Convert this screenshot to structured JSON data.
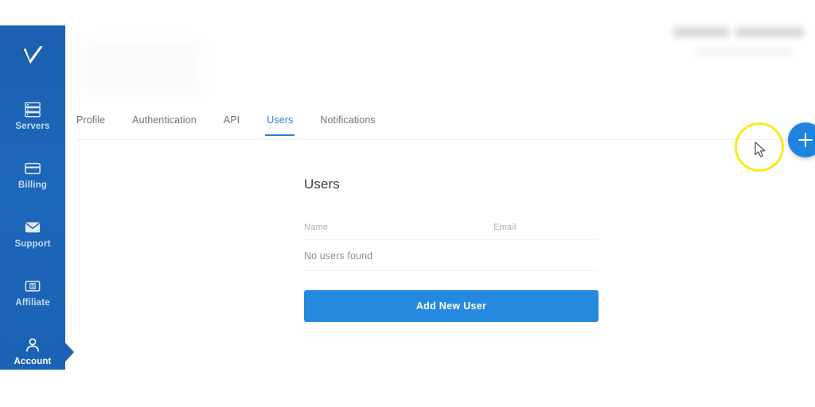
{
  "brand": {
    "logo_name": "checkmark-logo",
    "sidebar_color": "#1a62b4",
    "accent_color": "#2589e0",
    "tab_active_color": "#2b7fd4",
    "highlight_color": "#f5eb18"
  },
  "sidebar": {
    "items": [
      {
        "label": "Servers",
        "icon": "servers-icon",
        "active": false
      },
      {
        "label": "Billing",
        "icon": "credit-card-icon",
        "active": false
      },
      {
        "label": "Support",
        "icon": "envelope-icon",
        "active": false
      },
      {
        "label": "Affiliate",
        "icon": "money-icon",
        "active": false
      },
      {
        "label": "Account",
        "icon": "person-icon",
        "active": true
      }
    ]
  },
  "tabs": [
    {
      "label": "Profile",
      "active": false
    },
    {
      "label": "Authentication",
      "active": false
    },
    {
      "label": "API",
      "active": false
    },
    {
      "label": "Users",
      "active": true
    },
    {
      "label": "Notifications",
      "active": false
    }
  ],
  "main": {
    "title": "Users",
    "table": {
      "columns": [
        "Name",
        "Email"
      ],
      "empty_message": "No users found",
      "rows": []
    },
    "add_button_label": "Add New User"
  },
  "fab": {
    "icon": "plus-icon",
    "label": "+"
  }
}
